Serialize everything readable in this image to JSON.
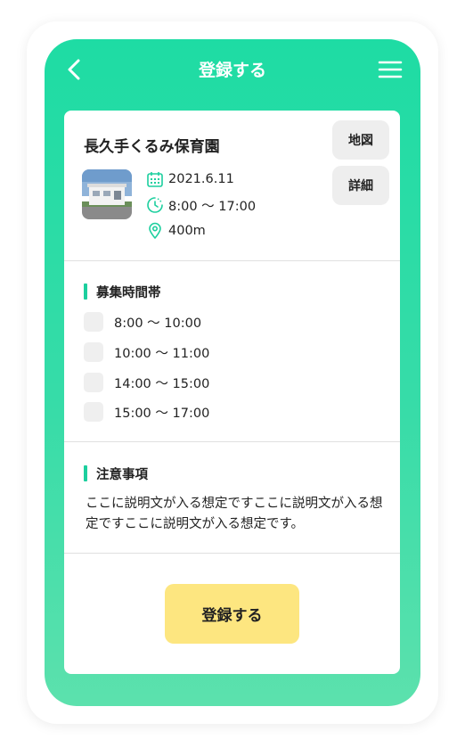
{
  "header": {
    "title": "登録する"
  },
  "facility": {
    "name": "長久手くるみ保育園",
    "date": "2021.6.11",
    "hours": "8:00 〜 17:00",
    "distance": "400m",
    "map_button": "地図",
    "detail_button": "詳細"
  },
  "time_slots": {
    "heading": "募集時間帯",
    "items": [
      {
        "label": "8:00 〜 10:00",
        "checked": false
      },
      {
        "label": "10:00 〜 11:00",
        "checked": false
      },
      {
        "label": "14:00 〜 15:00",
        "checked": false
      },
      {
        "label": "15:00 〜 17:00",
        "checked": false
      }
    ]
  },
  "notes": {
    "heading": "注意事項",
    "text": "ここに説明文が入る想定ですここに説明文が入る想定ですここに説明文が入る想定です。"
  },
  "register_button": "登録する",
  "colors": {
    "accent": "#1edca4",
    "button": "#fde680"
  },
  "icons": [
    "back-icon",
    "menu-icon",
    "calendar-icon",
    "clock-icon",
    "location-pin-icon"
  ]
}
